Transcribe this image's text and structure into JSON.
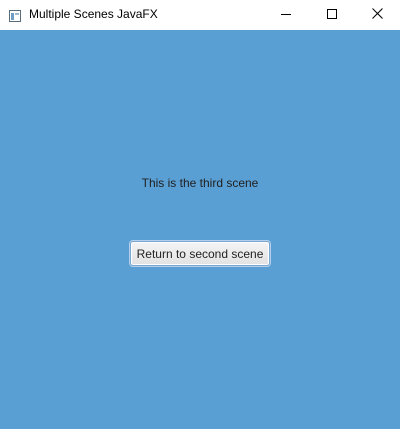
{
  "window": {
    "title": "Multiple Scenes JavaFX",
    "icon": "javafx-window-icon",
    "controls": {
      "minimize_icon": "minimize-icon",
      "maximize_icon": "maximize-icon",
      "close_icon": "close-icon"
    }
  },
  "scene": {
    "label": "This is the third scene",
    "button_label": "Return to second scene",
    "background_color": "#5a9fd4"
  }
}
